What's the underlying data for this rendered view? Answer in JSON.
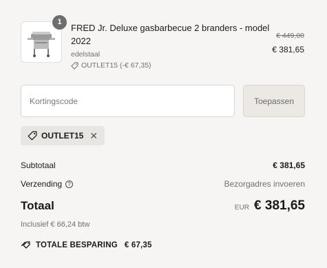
{
  "cart": {
    "item": {
      "quantity": "1",
      "title": "FRED Jr. Deluxe gasbarbecue 2 branders - model 2022",
      "variant": "edelstaal",
      "discount_label": "OUTLET15 (-€ 67,35)",
      "original_price": "€ 449,00",
      "sale_price": "€ 381,65",
      "image_icon": "grill-icon"
    }
  },
  "discount": {
    "placeholder": "Kortingscode",
    "apply_label": "Toepassen",
    "applied_code": "OUTLET15",
    "remove_symbol": "✕"
  },
  "summary": {
    "subtotal_label": "Subtotaal",
    "subtotal_value": "€ 381,65",
    "shipping_label": "Verzending",
    "shipping_value": "Bezorgadres invoeren",
    "total_label": "Totaal",
    "currency": "EUR",
    "total_value": "€ 381,65",
    "tax_note": "Inclusief € 66,24 btw",
    "savings_label": "TOTALE BESPARING",
    "savings_value": "€ 67,35"
  },
  "colors": {
    "background": "#f6f5f3",
    "badge": "#6d6d6d",
    "muted_text": "#707070",
    "tag_background": "#e8e6e3"
  }
}
